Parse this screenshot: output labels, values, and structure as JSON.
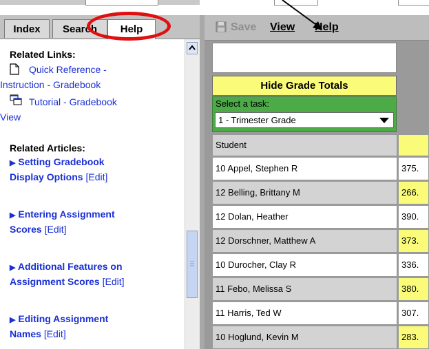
{
  "tabs": [
    {
      "label": "Index"
    },
    {
      "label": "Search"
    },
    {
      "label": "Help"
    }
  ],
  "help": {
    "related_links_title": "Related Links:",
    "links": [
      {
        "line1": "Quick Reference -",
        "line2": "Instruction - Gradebook",
        "icon": "document-icon"
      },
      {
        "line1": "Tutorial - Gradebook",
        "line2": "View",
        "icon": "windows-icon"
      }
    ],
    "related_articles_title": "Related Articles:",
    "articles": [
      {
        "line1": "Setting Gradebook",
        "line2": "Display Options",
        "edit": "[Edit]"
      },
      {
        "line1": "Entering Assignment",
        "line2": "Scores",
        "edit": "[Edit]"
      },
      {
        "line1": "Additional Features on",
        "line2": "Assignment Scores",
        "edit": "[Edit]"
      },
      {
        "line1": "Editing Assignment",
        "line2": "Names",
        "edit": "[Edit]"
      }
    ]
  },
  "toolbar": {
    "save_label": "Save",
    "view_label": "View",
    "help_label": "Help"
  },
  "gradebook": {
    "hide_totals_label": "Hide Grade Totals",
    "task_label": "Select a task:",
    "task_value": "1 - Trimester Grade",
    "student_header": "Student",
    "rows": [
      {
        "name": "10 Appel, Stephen R",
        "score": "375."
      },
      {
        "name": "12 Belling, Brittany M",
        "score": "266."
      },
      {
        "name": "12 Dolan, Heather",
        "score": "390."
      },
      {
        "name": "12 Dorschner, Matthew A",
        "score": "373."
      },
      {
        "name": "10 Durocher, Clay R",
        "score": "336."
      },
      {
        "name": "11 Febo, Melissa S",
        "score": "380."
      },
      {
        "name": "11 Harris, Ted W",
        "score": "307."
      },
      {
        "name": "10 Hoglund, Kevin M",
        "score": "283."
      }
    ]
  },
  "colors": {
    "highlight_yellow": "#fbfb7a",
    "task_green": "#4caa47",
    "link_blue": "#1a2fd6",
    "annotation_red": "#e01010",
    "row_grey": "#d3d3d3"
  }
}
